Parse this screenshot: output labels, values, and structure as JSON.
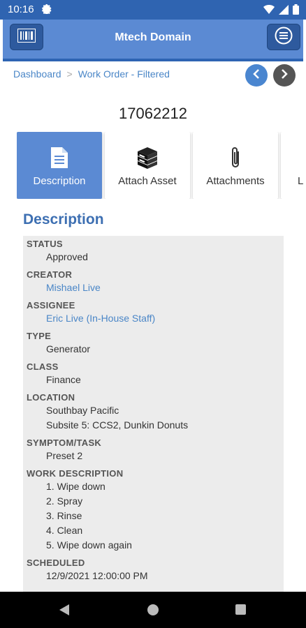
{
  "status_bar": {
    "time": "10:16"
  },
  "app_bar": {
    "title": "Mtech Domain"
  },
  "breadcrumb": {
    "items": [
      "Dashboard",
      "Work Order - Filtered"
    ],
    "separator": ">"
  },
  "work_order": {
    "number": "17062212"
  },
  "tabs": [
    {
      "label": "Description",
      "icon": "document-icon",
      "active": true
    },
    {
      "label": "Attach Asset",
      "icon": "asset-stack-icon",
      "active": false
    },
    {
      "label": "Attachments",
      "icon": "paperclip-icon",
      "active": false
    },
    {
      "label": "L",
      "icon": "",
      "active": false
    }
  ],
  "section": {
    "title": "Description"
  },
  "details": {
    "status": {
      "label": "STATUS",
      "value": "Approved"
    },
    "creator": {
      "label": "CREATOR",
      "value": "Mishael Live"
    },
    "assignee": {
      "label": "ASSIGNEE",
      "value": "Eric Live (In-House Staff)"
    },
    "type": {
      "label": "TYPE",
      "value": "Generator"
    },
    "class": {
      "label": "CLASS",
      "value": "Finance"
    },
    "location": {
      "label": "LOCATION",
      "values": [
        "Southbay Pacific",
        "Subsite 5: CCS2, Dunkin Donuts"
      ]
    },
    "symptom": {
      "label": "SYMPTOM/TASK",
      "value": "Preset 2"
    },
    "work_description": {
      "label": "WORK DESCRIPTION",
      "values": [
        "1. Wipe down",
        "2. Spray",
        "3. Rinse",
        "4. Clean",
        "5. Wipe down again"
      ]
    },
    "scheduled": {
      "label": "SCHEDULED",
      "value": "12/9/2021 12:00:00 PM"
    }
  },
  "colors": {
    "primary": "#5b8ad3",
    "status_bar": "#2f64b1",
    "link": "#4a86c7"
  }
}
